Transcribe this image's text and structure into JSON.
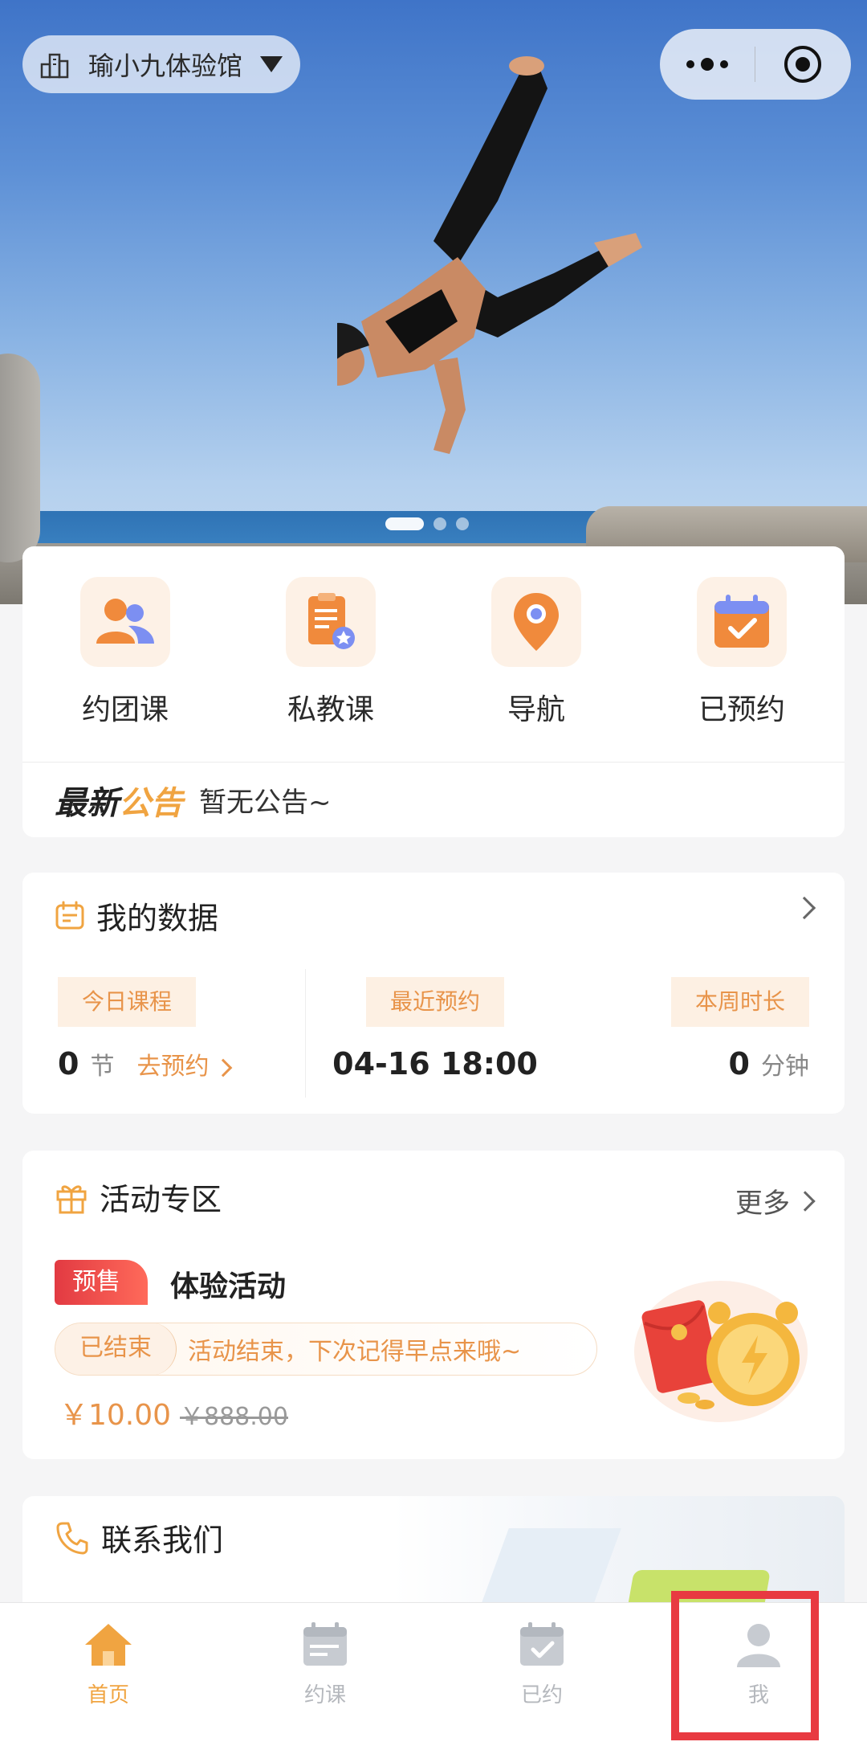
{
  "header": {
    "store_name": "瑜小九体验馆"
  },
  "banner": {
    "slide_count": 3,
    "active_slide": 1
  },
  "quick_menu": [
    {
      "label": "约团课",
      "icon": "group-users-icon"
    },
    {
      "label": "私教课",
      "icon": "private-coach-icon"
    },
    {
      "label": "导航",
      "icon": "location-pin-icon"
    },
    {
      "label": "已预约",
      "icon": "calendar-check-icon"
    }
  ],
  "notice": {
    "tag_part1": "最新",
    "tag_part2": "公告",
    "text": "暂无公告~"
  },
  "my_data": {
    "title": "我的数据",
    "today_label": "今日课程",
    "today_value": "0",
    "today_unit": "节",
    "book_link": "去预约",
    "recent_label": "最近预约",
    "recent_value": "04-16 18:00",
    "week_label": "本周时长",
    "week_value": "0",
    "week_unit": "分钟"
  },
  "activity": {
    "title": "活动专区",
    "more": "更多",
    "badge": "预售",
    "name": "体验活动",
    "status": "已结束",
    "status_msg": "活动结束，下次记得早点来哦~",
    "price": "￥10.00",
    "original_price": "￥888.00"
  },
  "contact": {
    "title": "联系我们"
  },
  "tabbar": [
    {
      "label": "首页",
      "icon": "home-icon",
      "active": true
    },
    {
      "label": "约课",
      "icon": "calendar-icon",
      "active": false
    },
    {
      "label": "已约",
      "icon": "calendar-check-icon",
      "active": false
    },
    {
      "label": "我",
      "icon": "user-icon",
      "active": false
    }
  ],
  "colors": {
    "accent": "#f0a441",
    "accent_text": "#e8944a",
    "badge_red": "#e23a42",
    "highlight": "#e83a41"
  }
}
